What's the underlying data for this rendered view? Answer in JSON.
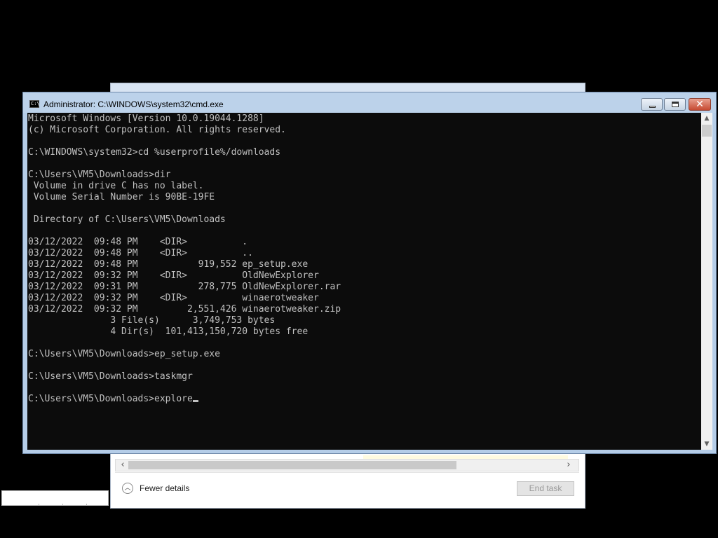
{
  "cmd": {
    "title": "Administrator: C:\\WINDOWS\\system32\\cmd.exe",
    "icon": "cmd-icon",
    "icon_text": "C:\\",
    "output_lines": [
      "Microsoft Windows [Version 10.0.19044.1288]",
      "(c) Microsoft Corporation. All rights reserved.",
      "",
      "C:\\WINDOWS\\system32>cd %userprofile%/downloads",
      "",
      "C:\\Users\\VM5\\Downloads>dir",
      " Volume in drive C has no label.",
      " Volume Serial Number is 90BE-19FE",
      "",
      " Directory of C:\\Users\\VM5\\Downloads",
      "",
      "03/12/2022  09:48 PM    <DIR>          .",
      "03/12/2022  09:48 PM    <DIR>          ..",
      "03/12/2022  09:48 PM           919,552 ep_setup.exe",
      "03/12/2022  09:32 PM    <DIR>          OldNewExplorer",
      "03/12/2022  09:31 PM           278,775 OldNewExplorer.rar",
      "03/12/2022  09:32 PM    <DIR>          winaerotweaker",
      "03/12/2022  09:32 PM         2,551,426 winaerotweaker.zip",
      "               3 File(s)      3,749,753 bytes",
      "               4 Dir(s)  101,413,150,720 bytes free",
      "",
      "C:\\Users\\VM5\\Downloads>ep_setup.exe",
      "",
      "C:\\Users\\VM5\\Downloads>taskmgr",
      ""
    ],
    "prompt_line": "C:\\Users\\VM5\\Downloads>explore"
  },
  "task_manager": {
    "fewer_details_label": "Fewer details",
    "end_task_label": "End task"
  }
}
